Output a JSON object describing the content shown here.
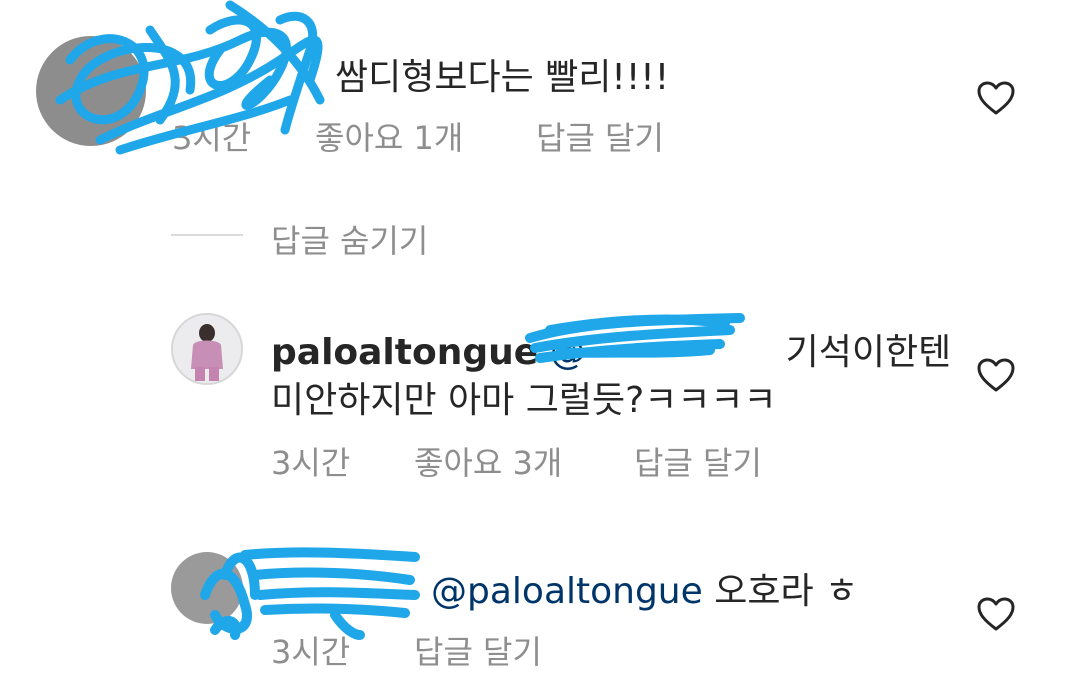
{
  "comments": [
    {
      "text": "쌈디형보다는 빨리!!!!",
      "time": "3시간",
      "likes": "좋아요 1개",
      "reply": "답글 달기"
    },
    {
      "username": "paloaltongue",
      "mention": "@",
      "text_line1": "기석이한텐",
      "text_line2": "미안하지만 아마 그럴듯?ㅋㅋㅋㅋ",
      "time": "3시간",
      "likes": "좋아요 3개",
      "reply": "답글 달기"
    },
    {
      "mention": "@paloaltongue",
      "text": "오호라 ㅎ",
      "time": "3시간",
      "reply": "답글 달기"
    }
  ],
  "hide_replies": "답글 숨기기"
}
